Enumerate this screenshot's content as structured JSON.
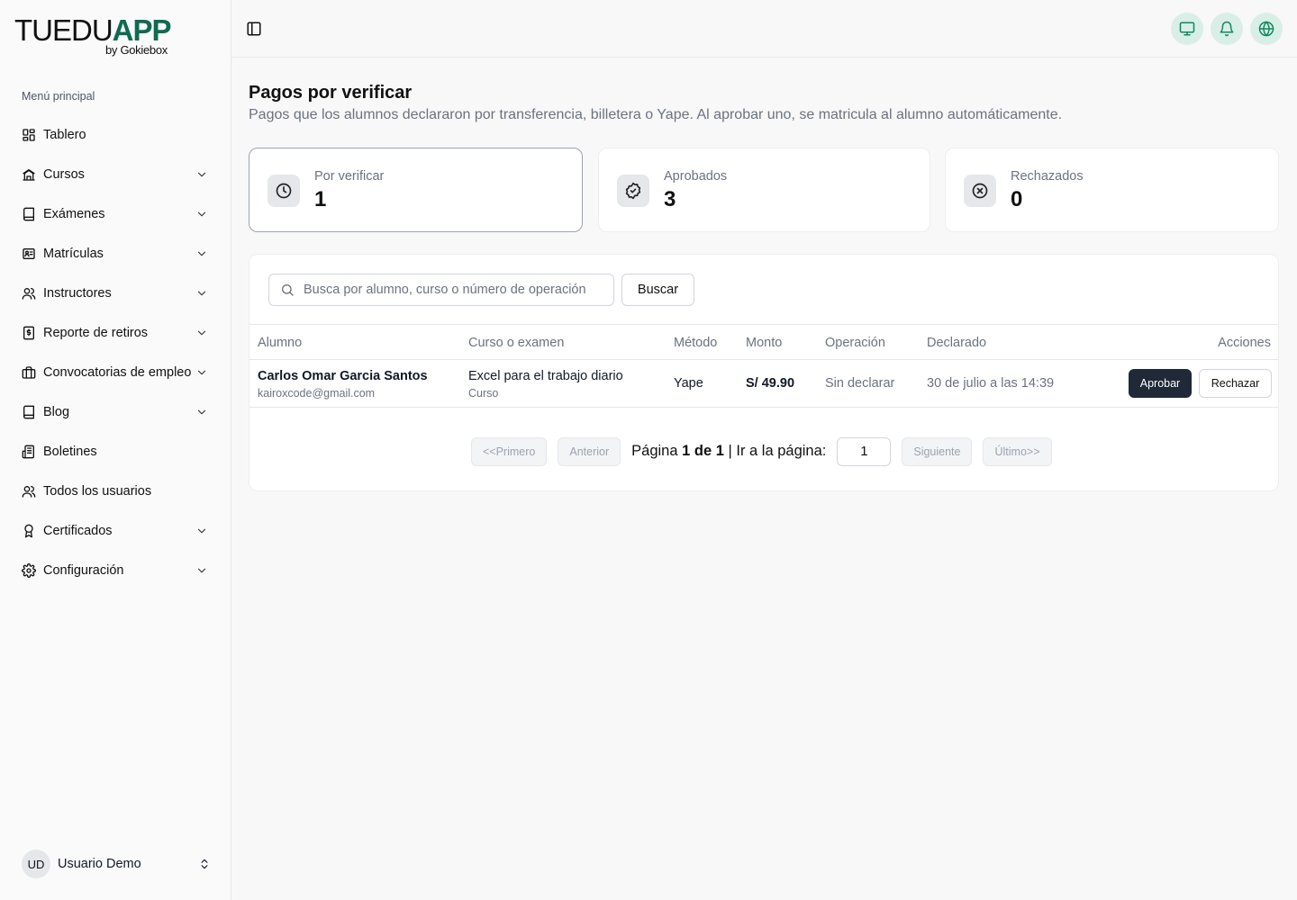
{
  "brand": {
    "part1": "TUEDU",
    "part2": "APP",
    "sub": "by Gokiebox",
    "accent": "#0f6b4f"
  },
  "sidebar": {
    "heading": "Menú principal",
    "items": [
      {
        "label": "Tablero",
        "icon": "dashboard-icon",
        "chevron": false
      },
      {
        "label": "Cursos",
        "icon": "courses-icon",
        "chevron": true
      },
      {
        "label": "Exámenes",
        "icon": "book-icon",
        "chevron": true
      },
      {
        "label": "Matrículas",
        "icon": "enrollment-icon",
        "chevron": true
      },
      {
        "label": "Instructores",
        "icon": "users-icon",
        "chevron": true
      },
      {
        "label": "Reporte de retiros",
        "icon": "money-report-icon",
        "chevron": true
      },
      {
        "label": "Convocatorias de empleo",
        "icon": "briefcase-icon",
        "chevron": true
      },
      {
        "label": "Blog",
        "icon": "book-icon",
        "chevron": true
      },
      {
        "label": "Boletines",
        "icon": "newsletter-icon",
        "chevron": false
      },
      {
        "label": "Todos los usuarios",
        "icon": "users-icon",
        "chevron": false
      },
      {
        "label": "Certificados",
        "icon": "award-icon",
        "chevron": true
      },
      {
        "label": "Configuración",
        "icon": "gear-icon",
        "chevron": true
      }
    ],
    "user": {
      "initials": "UD",
      "name": "Usuario Demo"
    }
  },
  "page": {
    "title": "Pagos por verificar",
    "description": "Pagos que los alumnos declararon por transferencia, billetera o Yape. Al aprobar uno, se matricula al alumno automáticamente."
  },
  "stats": [
    {
      "label": "Por verificar",
      "value": "1",
      "icon": "clock-icon"
    },
    {
      "label": "Aprobados",
      "value": "3",
      "icon": "check-badge-icon"
    },
    {
      "label": "Rechazados",
      "value": "0",
      "icon": "x-circle-icon"
    }
  ],
  "search": {
    "placeholder": "Busca por alumno, curso o número de operación",
    "button": "Buscar"
  },
  "table": {
    "headers": [
      "Alumno",
      "Curso o examen",
      "Método",
      "Monto",
      "Operación",
      "Declarado",
      "Acciones"
    ],
    "rows": [
      {
        "student_name": "Carlos Omar Garcia Santos",
        "student_email": "kairoxcode@gmail.com",
        "course": "Excel para el trabajo diario",
        "course_type": "Curso",
        "method": "Yape",
        "amount": "S/ 49.90",
        "operation": "Sin declarar",
        "declared": "30 de julio a las 14:39",
        "approve": "Aprobar",
        "reject": "Rechazar"
      }
    ]
  },
  "pagination": {
    "first": "<<Primero",
    "prev": "Anterior",
    "page_word": "Página",
    "current_total": "1 de 1",
    "goto": "| Ir a la página:",
    "input_value": "1",
    "next": "Siguiente",
    "last": "Último>>"
  }
}
